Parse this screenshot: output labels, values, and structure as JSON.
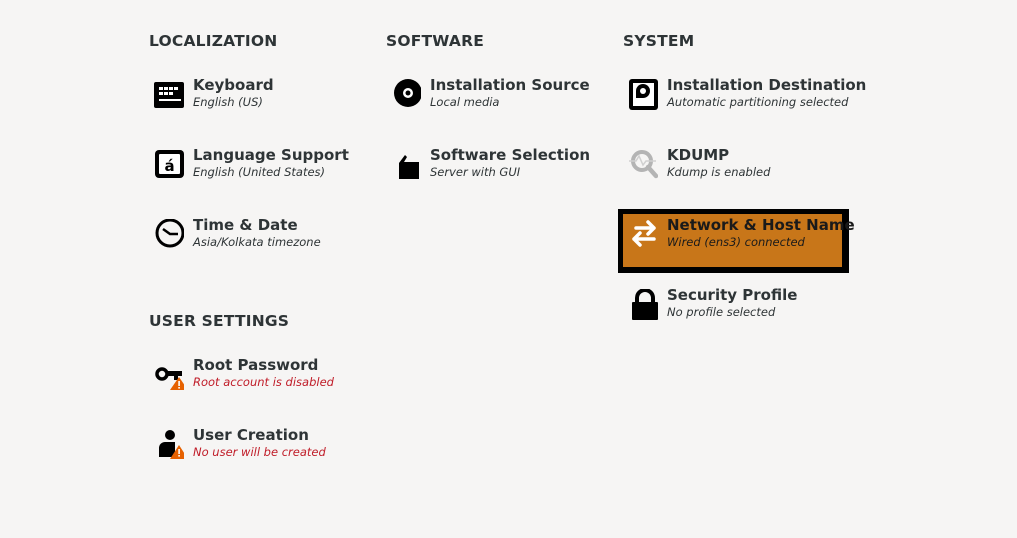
{
  "sections": {
    "localization": {
      "title": "LOCALIZATION",
      "items": [
        {
          "icon": "keyboard-icon",
          "title": "Keyboard",
          "status": "English (US)",
          "warning": false
        },
        {
          "icon": "language-icon",
          "title": "Language Support",
          "status": "English (United States)",
          "warning": false
        },
        {
          "icon": "clock-icon",
          "title": "Time & Date",
          "status": "Asia/Kolkata timezone",
          "warning": false
        }
      ]
    },
    "software": {
      "title": "SOFTWARE",
      "items": [
        {
          "icon": "disc-icon",
          "title": "Installation Source",
          "status": "Local media",
          "warning": false
        },
        {
          "icon": "package-icon",
          "title": "Software Selection",
          "status": "Server with GUI",
          "warning": false
        }
      ]
    },
    "system": {
      "title": "SYSTEM",
      "items": [
        {
          "icon": "disk-icon",
          "title": "Installation Destination",
          "status": "Automatic partitioning selected",
          "warning": false
        },
        {
          "icon": "kdump-magnifier-icon",
          "title": "KDUMP",
          "status": "Kdump is enabled",
          "warning": false
        },
        {
          "icon": "network-arrows-icon",
          "title": "Network & Host Name",
          "status": "Wired (ens3) connected",
          "warning": false,
          "selected": true
        },
        {
          "icon": "lock-icon",
          "title": "Security Profile",
          "status": "No profile selected",
          "warning": false
        }
      ]
    },
    "user_settings": {
      "title": "USER SETTINGS",
      "items": [
        {
          "icon": "key-icon",
          "title": "Root Password",
          "status": "Root account is disabled",
          "warning": true
        },
        {
          "icon": "user-icon",
          "title": "User Creation",
          "status": "No user will be created",
          "warning": true
        }
      ]
    }
  },
  "colors": {
    "background": "#f6f5f4",
    "selected_fill": "#c87619",
    "selected_border": "#000000",
    "warning_text": "#c01c28",
    "warning_badge": "#e66100"
  }
}
